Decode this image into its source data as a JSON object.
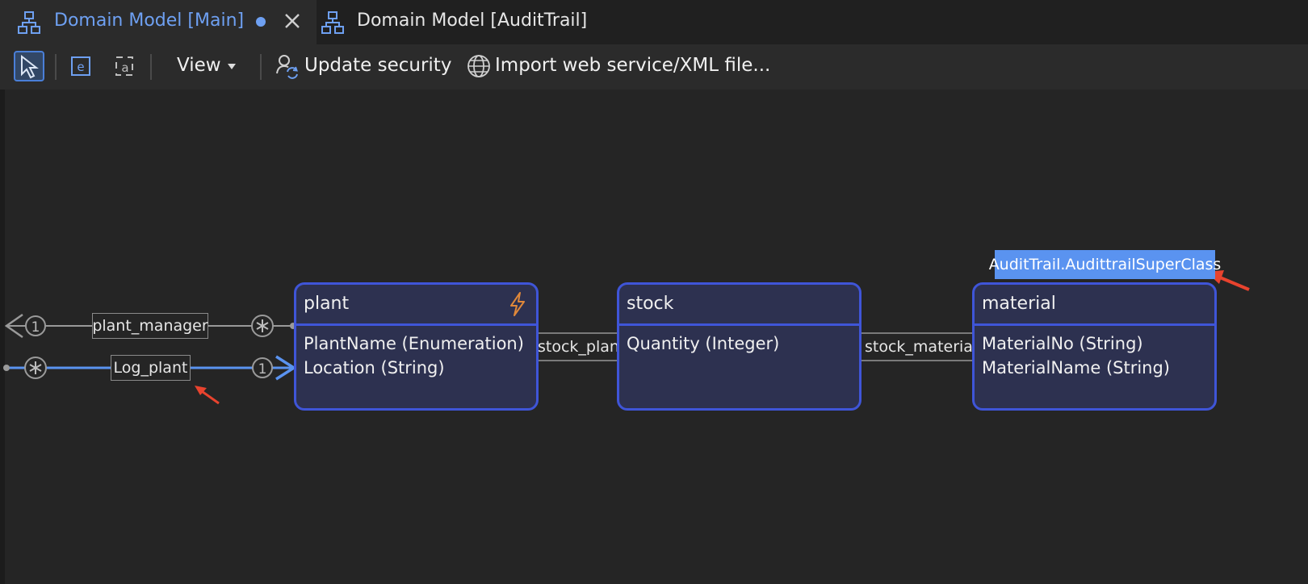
{
  "tabs": [
    {
      "label": "Domain Model [Main]",
      "active": true,
      "dirty": true
    },
    {
      "label": "Domain Model [AuditTrail]",
      "active": false
    }
  ],
  "toolbar": {
    "view_label": "View",
    "update_security_label": "Update security",
    "import_label": "Import web service/XML file..."
  },
  "associations": {
    "plant_manager": {
      "label": "plant_manager",
      "left_multiplicity": "1",
      "right_multiplicity": "*"
    },
    "log_plant": {
      "label": "Log_plant",
      "left_multiplicity": "*",
      "right_multiplicity": "1"
    },
    "stock_plant": {
      "label": "stock_plant"
    },
    "stock_material": {
      "label": "stock_material"
    }
  },
  "entities": {
    "plant": {
      "name": "plant",
      "attributes": [
        "PlantName (Enumeration)",
        "Location (String)"
      ],
      "event_handler_icon": "lightning-icon"
    },
    "stock": {
      "name": "stock",
      "attributes": [
        "Quantity (Integer)"
      ]
    },
    "material": {
      "name": "material",
      "attributes": [
        "MaterialNo (String)",
        "MaterialName (String)"
      ],
      "generalization": "AuditTrail.AudittrailSuperClass"
    }
  },
  "colors": {
    "accent": "#6ea0f2",
    "entity_border": "#3f55d8",
    "entity_fill": "#2d3150",
    "highlight_line": "#5a93f0",
    "annotation_arrow": "#e8432e",
    "lightning": "#e0883a"
  }
}
